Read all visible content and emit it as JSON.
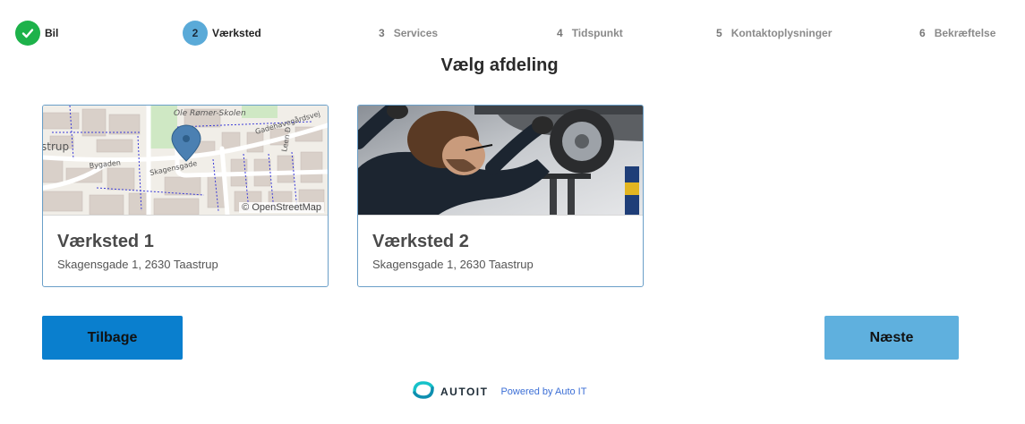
{
  "stepper": {
    "steps": [
      {
        "number": "✓",
        "label": "Bil",
        "state": "done"
      },
      {
        "number": "2",
        "label": "Værksted",
        "state": "active"
      },
      {
        "number": "3",
        "label": "Services",
        "state": "todo"
      },
      {
        "number": "4",
        "label": "Tidspunkt",
        "state": "todo"
      },
      {
        "number": "5",
        "label": "Kontaktoplysninger",
        "state": "todo"
      },
      {
        "number": "6",
        "label": "Bekræftelse",
        "state": "todo"
      }
    ]
  },
  "page": {
    "title": "Vælg afdeling"
  },
  "workshops": [
    {
      "name": "Værksted 1",
      "address": "Skagensgade 1, 2630 Taastrup",
      "media": "map",
      "map_labels": [
        "Ole Rømer-Skolen",
        "Skagensgade",
        "Bygaden",
        "Gadehavegårdsvej",
        "Leen D",
        "strup"
      ],
      "attribution": "© OpenStreetMap"
    },
    {
      "name": "Værksted 2",
      "address": "Skagensgade 1, 2630 Taastrup",
      "media": "photo-mechanic-under-car"
    }
  ],
  "actions": {
    "back_label": "Tilbage",
    "next_label": "Næste"
  },
  "footer": {
    "brand": "AUTOIT",
    "powered_by": "Powered by Auto IT"
  },
  "colors": {
    "success": "#1db24a",
    "active_step": "#5aaad8",
    "primary": "#0a7fce",
    "secondary": "#5fb0de",
    "card_border": "#6a9fc8"
  }
}
